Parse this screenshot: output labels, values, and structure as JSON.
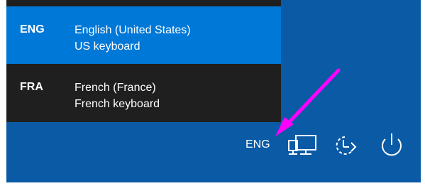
{
  "language_menu": {
    "items": [
      {
        "code": "ENG",
        "name": "English (United States)",
        "keyboard": "US keyboard",
        "selected": true
      },
      {
        "code": "FRA",
        "name": "French (France)",
        "keyboard": "French keyboard",
        "selected": false
      }
    ]
  },
  "status_bar": {
    "input_indicator": "ENG",
    "icons": [
      "network-icon",
      "ease-of-access-icon",
      "power-icon"
    ]
  },
  "colors": {
    "lockscreen_bg": "#0a5aa6",
    "selected_item": "#0078d7",
    "menu_bg": "#1f1f1f",
    "annotation_arrow": "#ff00ff"
  }
}
